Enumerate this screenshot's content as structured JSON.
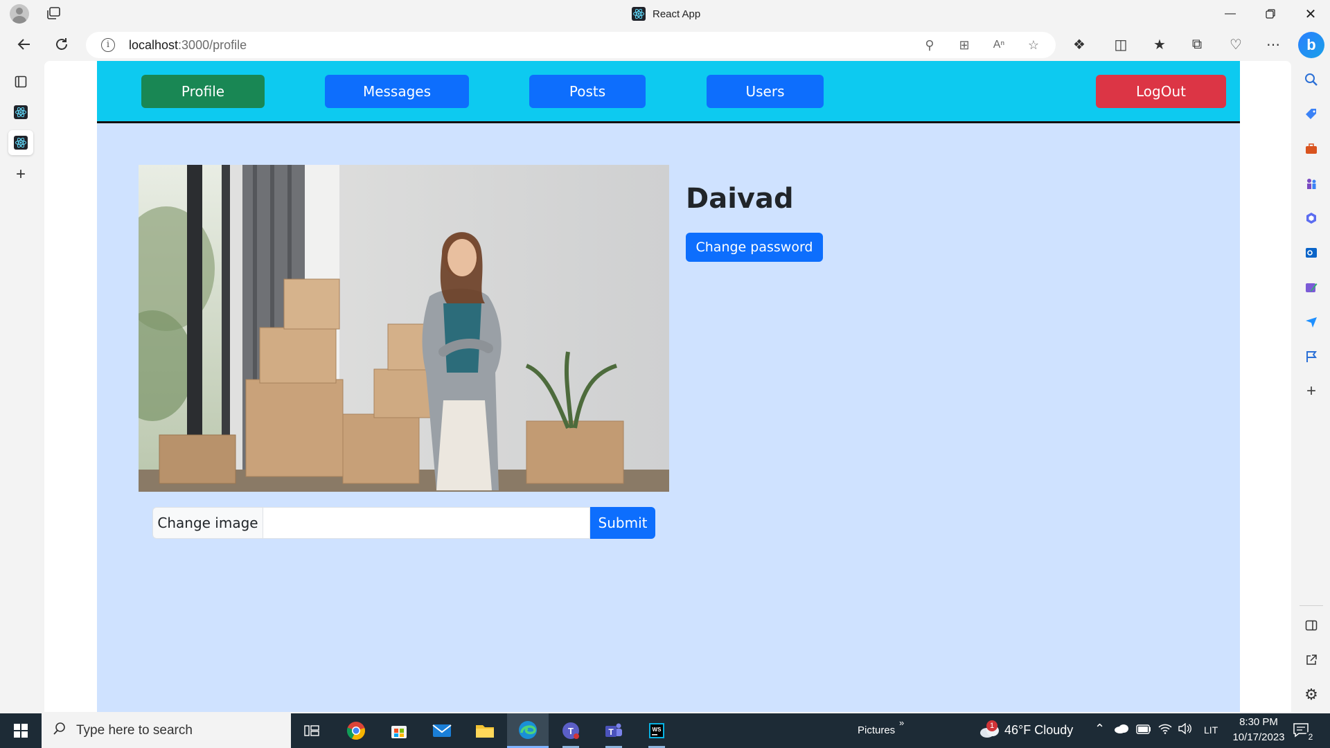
{
  "browser": {
    "window_title": "React App",
    "url_host": "localhost",
    "url_path": ":3000/profile"
  },
  "app": {
    "nav": {
      "profile": "Profile",
      "messages": "Messages",
      "posts": "Posts",
      "users": "Users",
      "logout": "LogOut"
    },
    "profile": {
      "username": "Daivad",
      "change_password": "Change password",
      "change_image": "Change image",
      "image_input_value": "",
      "submit": "Submit"
    }
  },
  "taskbar": {
    "search_placeholder": "Type here to search",
    "pictures_label": "Pictures",
    "weather": "46°F  Cloudy",
    "weather_badge": "1",
    "language": "LIT",
    "time": "8:30 PM",
    "date": "10/17/2023",
    "notifications": "2"
  },
  "colors": {
    "nav_bg": "#0dcaf0",
    "page_bg": "#cfe2ff",
    "primary": "#0d6efd",
    "success": "#198754",
    "danger": "#dc3545"
  }
}
